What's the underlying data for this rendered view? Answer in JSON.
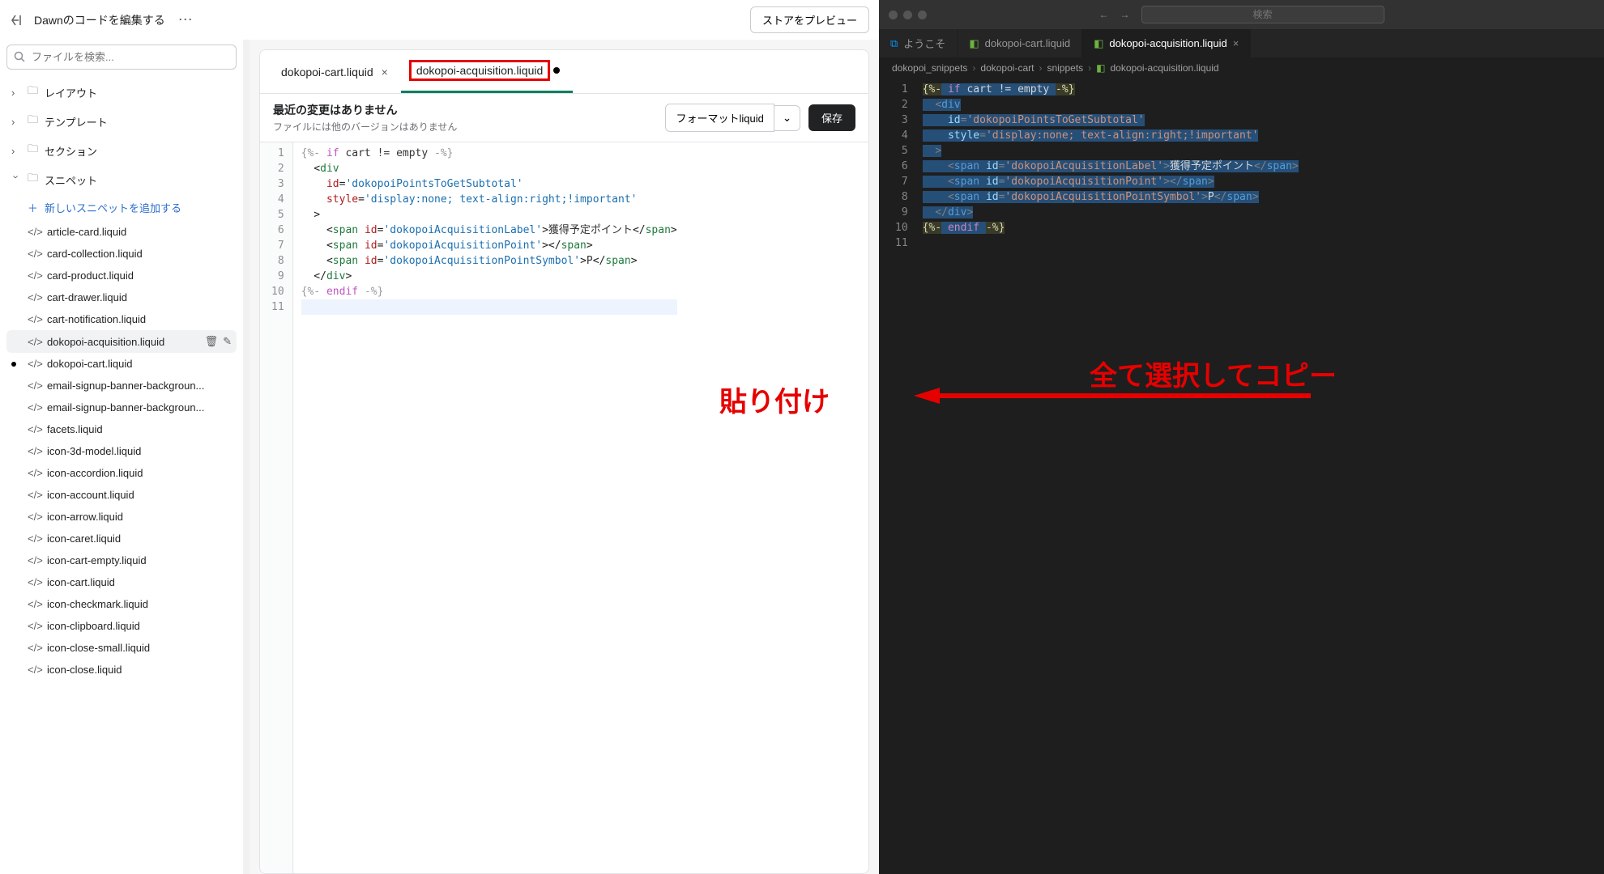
{
  "left": {
    "title": "Dawnのコードを編集する",
    "preview_btn": "ストアをプレビュー",
    "search_placeholder": "ファイルを検索...",
    "folders": {
      "layout": "レイアウト",
      "templates": "テンプレート",
      "sections": "セクション",
      "snippets": "スニペット"
    },
    "add_snippet": "新しいスニペットを追加する",
    "files": [
      "article-card.liquid",
      "card-collection.liquid",
      "card-product.liquid",
      "cart-drawer.liquid",
      "cart-notification.liquid",
      "dokopoi-acquisition.liquid",
      "dokopoi-cart.liquid",
      "email-signup-banner-backgroun...",
      "email-signup-banner-backgroun...",
      "facets.liquid",
      "icon-3d-model.liquid",
      "icon-accordion.liquid",
      "icon-account.liquid",
      "icon-arrow.liquid",
      "icon-caret.liquid",
      "icon-cart-empty.liquid",
      "icon-cart.liquid",
      "icon-checkmark.liquid",
      "icon-clipboard.liquid",
      "icon-close-small.liquid",
      "icon-close.liquid"
    ],
    "active_file_index": 5,
    "modified_file_index": 6,
    "tabs": [
      {
        "label": "dokopoi-cart.liquid",
        "close": "×"
      },
      {
        "label": "dokopoi-acquisition.liquid",
        "dirty": true
      }
    ],
    "subhead_title": "最近の変更はありません",
    "subhead_sub": "ファイルには他のバージョンはありません",
    "format_btn": "フォーマットliquid",
    "save_btn": "保存",
    "code_lines": [
      "1",
      "2",
      "3",
      "4",
      "5",
      "6",
      "7",
      "8",
      "9",
      "10",
      "11"
    ],
    "annotation_paste": "貼り付け"
  },
  "right": {
    "search_placeholder": "検索",
    "tabs": {
      "welcome": "ようこそ",
      "t1": "dokopoi-cart.liquid",
      "t2": "dokopoi-acquisition.liquid"
    },
    "breadcrumb": [
      "dokopoi_snippets",
      "dokopoi-cart",
      "snippets",
      "dokopoi-acquisition.liquid"
    ],
    "code_lines": [
      "1",
      "2",
      "3",
      "4",
      "5",
      "6",
      "7",
      "8",
      "9",
      "10",
      "11"
    ],
    "annotation_copy": "全て選択してコピー"
  },
  "code": {
    "liquid_open": "{%-",
    "liquid_close": "-%}",
    "if": "if",
    "endif": "endif",
    "cond": "cart != empty",
    "div": "div",
    "span": "span",
    "id": "id",
    "style": "style",
    "id1": "'dokopoiPointsToGetSubtotal'",
    "style1": "'display:none; text-align:right;!important'",
    "id2": "'dokopoiAcquisitionLabel'",
    "text2": "獲得予定ポイント",
    "id3": "'dokopoiAcquisitionPoint'",
    "id4": "'dokopoiAcquisitionPointSymbol'",
    "text4": "P"
  }
}
